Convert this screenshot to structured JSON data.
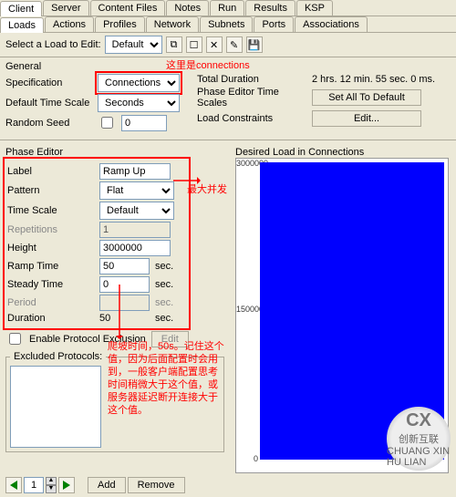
{
  "tabs_top": [
    "Client",
    "Server",
    "Content Files",
    "Notes",
    "Run",
    "Results",
    "KSP"
  ],
  "tabs_sub": [
    "Loads",
    "Actions",
    "Profiles",
    "Network",
    "Subnets",
    "Ports",
    "Associations"
  ],
  "toolbar": {
    "select_label": "Select a Load to Edit:",
    "profile": "Default"
  },
  "general": {
    "heading": "General",
    "spec_label": "Specification",
    "spec_value": "Connections",
    "dts_label": "Default Time Scale",
    "dts_value": "Seconds",
    "seed_label": "Random Seed",
    "seed_value": "0"
  },
  "right": {
    "dur_label": "Total Duration",
    "dur_value": "2 hrs. 12 min. 55 sec. 0 ms.",
    "pets_label": "Phase Editor Time Scales",
    "pets_btn": "Set All To Default",
    "lc_label": "Load Constraints",
    "lc_btn": "Edit..."
  },
  "phase": {
    "heading": "Phase Editor",
    "label_l": "Label",
    "label_v": "Ramp Up",
    "pattern_l": "Pattern",
    "pattern_v": "Flat",
    "ts_l": "Time Scale",
    "ts_v": "Default",
    "rep_l": "Repetitions",
    "rep_v": "1",
    "height_l": "Height",
    "height_v": "3000000",
    "ramp_l": "Ramp Time",
    "ramp_v": "50",
    "ramp_u": "sec.",
    "steady_l": "Steady Time",
    "steady_v": "0",
    "steady_u": "sec.",
    "period_l": "Period",
    "period_u": "sec.",
    "dur_l": "Duration",
    "dur_v": "50",
    "dur_u": "sec.",
    "epe_l": "Enable Protocol Exclusion",
    "epe_btn": "Edit",
    "exc_l": "Excluded Protocols:"
  },
  "chart_data": {
    "type": "area",
    "title": "Desired Load in Connections",
    "x": [
      0,
      50,
      7975
    ],
    "y": [
      0,
      3000000,
      3000000
    ],
    "ylim": [
      0,
      3000000
    ],
    "yticks": [
      0,
      1500000,
      3000000
    ],
    "xlabel": "",
    "ylabel": ""
  },
  "nav": {
    "page": "1",
    "add": "Add",
    "remove": "Remove"
  },
  "annot": {
    "conn": "这里是connections",
    "max": "最大并发",
    "ramp": "爬坡时间，50s。记住这个值，因为后面配置时会用到，一般客户端配置思考时间稍微大于这个值，或服务器延迟断开连接大于这个值。"
  },
  "logo": {
    "brand": "创新互联",
    "url": "CHUANG XIN HU LIAN"
  }
}
